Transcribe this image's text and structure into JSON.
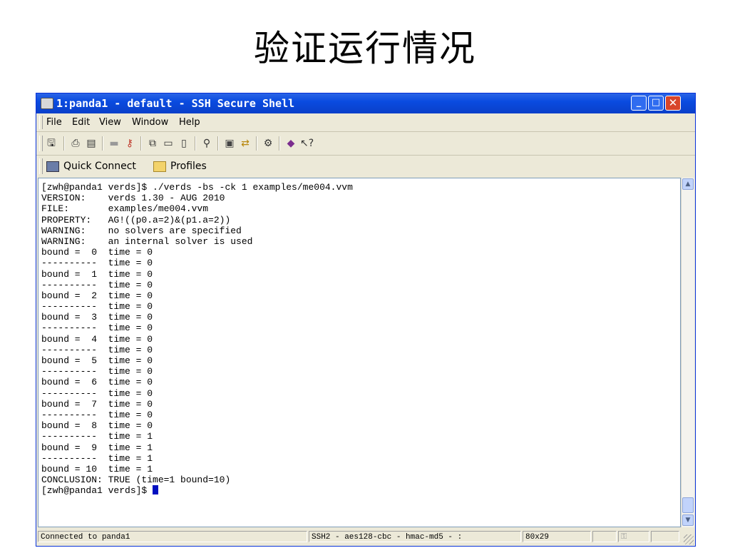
{
  "slide": {
    "title": "验证运行情况"
  },
  "window": {
    "title": "1:panda1 - default - SSH Secure Shell",
    "icon": "terminal-app-icon",
    "controls": {
      "minimize_icon": "minimize-icon",
      "maximize_icon": "maximize-icon",
      "close_icon": "close-icon"
    }
  },
  "menu": [
    "File",
    "Edit",
    "View",
    "Window",
    "Help"
  ],
  "toolbar": {
    "icons": [
      "save-icon",
      "print-icon",
      "print-preview-icon",
      "disconnect-icon",
      "key-icon",
      "copy-icon",
      "paste-icon",
      "paste-alt-icon",
      "find-icon",
      "new-terminal-icon",
      "file-transfer-icon",
      "settings-icon",
      "help-topics-icon",
      "whats-this-icon"
    ]
  },
  "quickbar": {
    "quick_connect": "Quick Connect",
    "profiles": "Profiles"
  },
  "terminal": {
    "lines": [
      "[zwh@panda1 verds]$ ./verds -bs -ck 1 examples/me004.vvm",
      "VERSION:    verds 1.30 - AUG 2010",
      "FILE:       examples/me004.vvm",
      "PROPERTY:   AG!((p0.a=2)&(p1.a=2))",
      "WARNING:    no solvers are specified",
      "WARNING:    an internal solver is used",
      "bound =  0  time = 0",
      "----------  time = 0",
      "bound =  1  time = 0",
      "----------  time = 0",
      "bound =  2  time = 0",
      "----------  time = 0",
      "bound =  3  time = 0",
      "----------  time = 0",
      "bound =  4  time = 0",
      "----------  time = 0",
      "bound =  5  time = 0",
      "----------  time = 0",
      "bound =  6  time = 0",
      "----------  time = 0",
      "bound =  7  time = 0",
      "----------  time = 0",
      "bound =  8  time = 0",
      "----------  time = 1",
      "bound =  9  time = 1",
      "----------  time = 1",
      "bound = 10  time = 1",
      "CONCLUSION: TRUE (time=1 bound=10)"
    ],
    "prompt": "[zwh@panda1 verds]$ "
  },
  "status": {
    "connection": "Connected to panda1",
    "cipher": "SSH2 - aes128-cbc - hmac-md5 - :",
    "size": "80x29"
  }
}
